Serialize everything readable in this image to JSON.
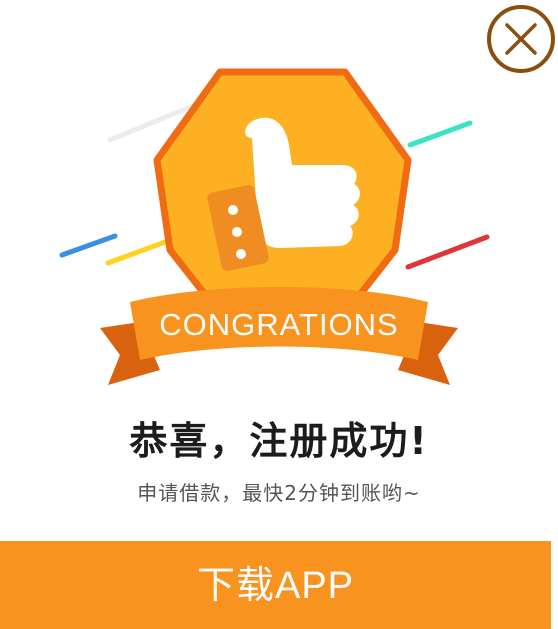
{
  "dialog": {
    "close_icon": "close-icon",
    "badge": {
      "ribbon_text": "CONGRATIONS",
      "icon": "thumbs-up-icon",
      "colors": {
        "badge_fill": "#fdb022",
        "badge_border": "#ef6c13",
        "ribbon": "#f7931e",
        "ribbon_dark": "#d9620f"
      }
    },
    "title": "恭喜，注册成功!",
    "subtitle": "申请借款，最快2分钟到账哟~",
    "download_button": {
      "label": "下载APP",
      "color": "#f7931e"
    },
    "close_color": "#8a4f0f"
  }
}
